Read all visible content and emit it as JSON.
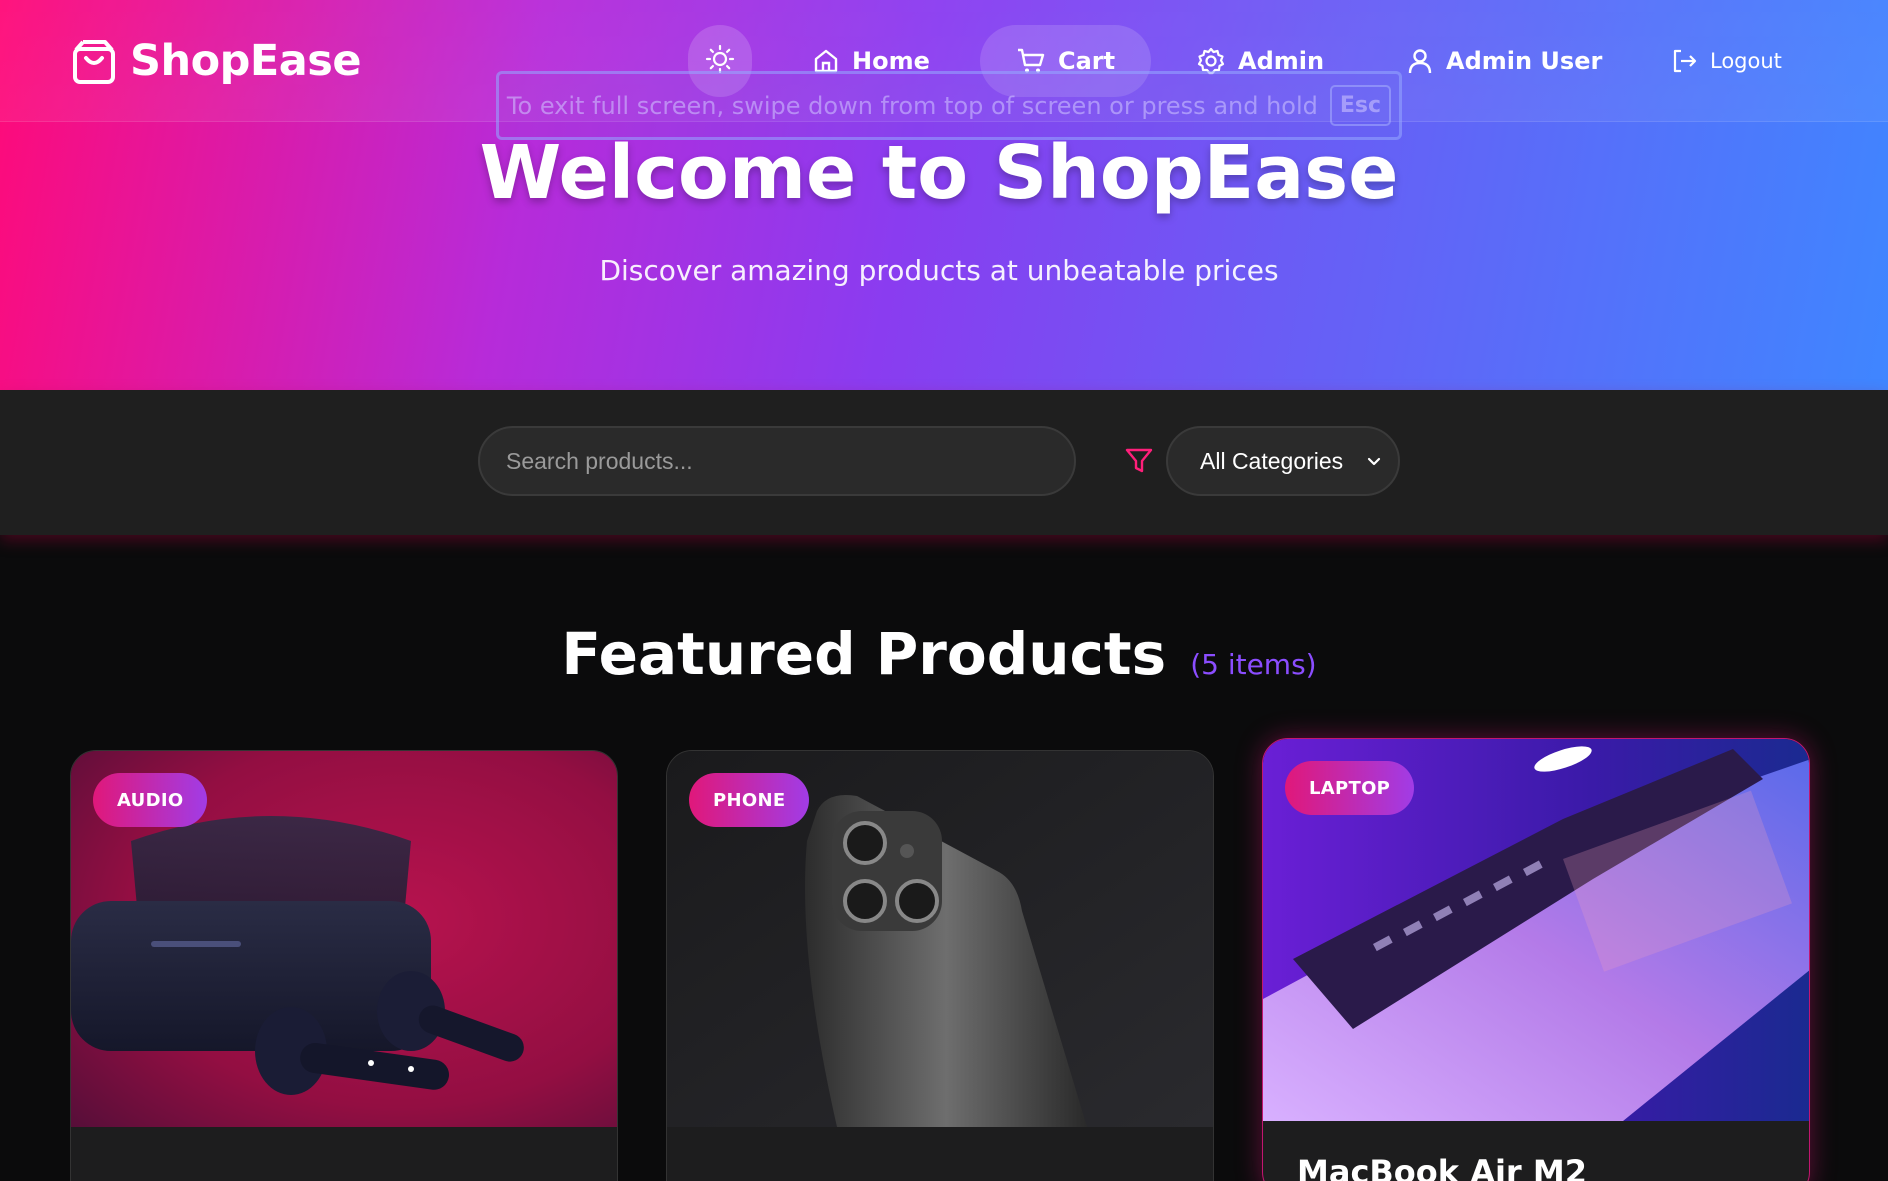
{
  "brand": {
    "name": "ShopEase"
  },
  "nav": {
    "theme_icon": "sun-icon",
    "home": "Home",
    "cart": "Cart",
    "admin": "Admin",
    "user": "Admin User",
    "logout": "Logout"
  },
  "fullscreen_notice": {
    "text": "To exit full screen, swipe down from top of screen or press and hold",
    "key": "Esc"
  },
  "hero": {
    "title": "Welcome to ShopEase",
    "subtitle": "Discover amazing products at unbeatable prices"
  },
  "filters": {
    "search_placeholder": "Search products...",
    "category_selected": "All Categories"
  },
  "featured": {
    "title": "Featured Products",
    "count": "(5 items)"
  },
  "products": [
    {
      "badge": "AUDIO",
      "name": ""
    },
    {
      "badge": "PHONE",
      "name": ""
    },
    {
      "badge": "LAPTOP",
      "name": "MacBook Air M2"
    }
  ],
  "colors": {
    "accent_pink": "#ff0a78",
    "accent_purple": "#8a3cf0",
    "accent_blue": "#3f86ff",
    "count_purple": "#8b4dff"
  }
}
